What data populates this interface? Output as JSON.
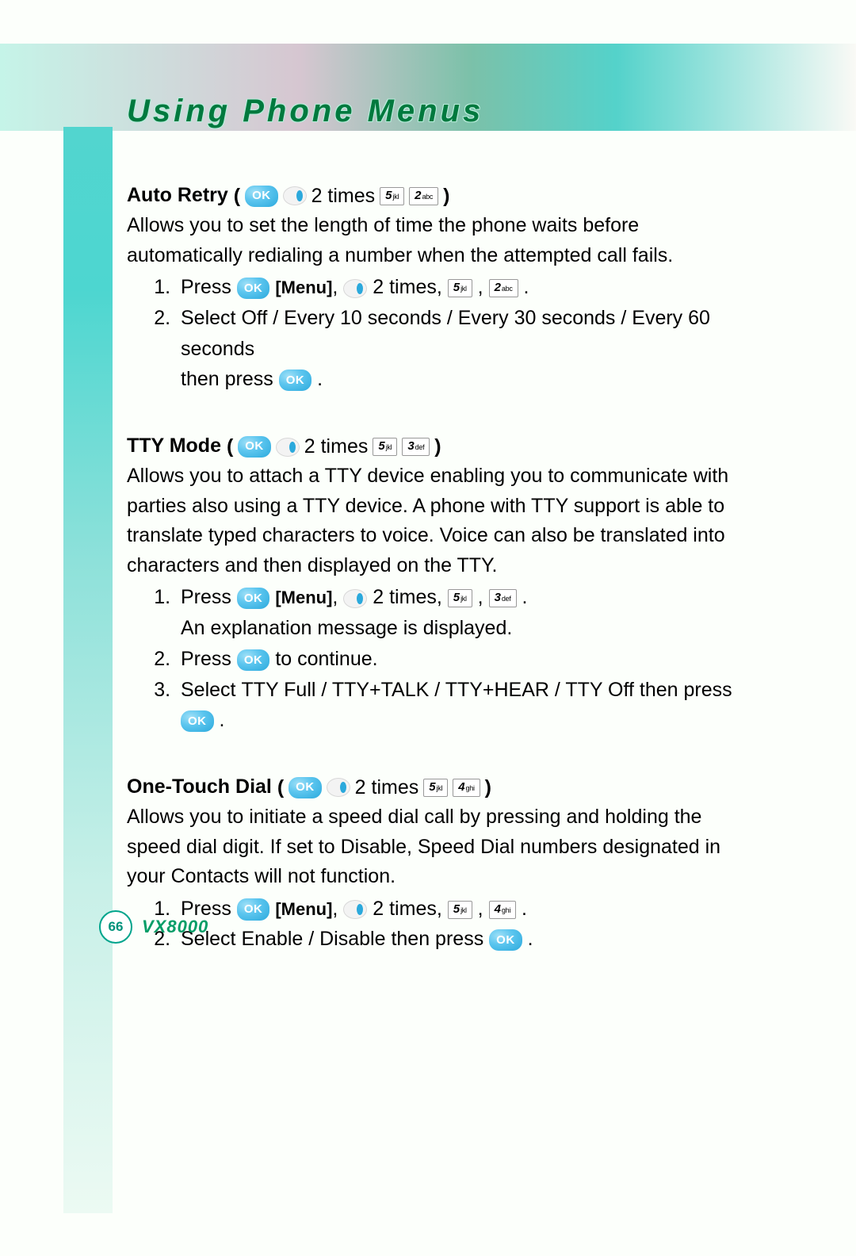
{
  "heading": "Using Phone Menus",
  "labels": {
    "ok": "OK",
    "twoTimes": "2 times",
    "twoTimesComma": "2 times,",
    "openParen": "(",
    "closeParen": ")",
    "comma": ",",
    "period": ".",
    "press": "Press",
    "menu": "[Menu]",
    "thenPress": "then press",
    "select": "Select",
    "toContinue": "to continue."
  },
  "keys": {
    "k2": {
      "num": "2",
      "letters": "abc"
    },
    "k3": {
      "num": "3",
      "letters": "def"
    },
    "k4": {
      "num": "4",
      "letters": "ghi"
    },
    "k5": {
      "num": "5",
      "letters": "jkl"
    }
  },
  "sections": {
    "autoRetry": {
      "title": "Auto Retry",
      "headKeyA": "k5",
      "headKeyB": "k2",
      "para": "Allows you to set the length of time the phone waits before automatically redialing a number when the attempted call fails.",
      "step1KeyA": "k5",
      "step1KeyB": "k2",
      "step2Options": "Off / Every 10 seconds / Every 30 seconds / Every 60 seconds"
    },
    "ttyMode": {
      "title": "TTY Mode",
      "headKeyA": "k5",
      "headKeyB": "k3",
      "para": "Allows you to attach a TTY device enabling you to communicate with parties also using a TTY device. A phone with TTY support is able to translate typed characters to voice. Voice can also be translated into characters and then displayed on the TTY.",
      "step1KeyA": "k5",
      "step1KeyB": "k3",
      "step1Tail": "An explanation message is displayed.",
      "step3Options": "TTY Full / TTY+TALK / TTY+HEAR / TTY Off"
    },
    "oneTouch": {
      "title": "One-Touch Dial",
      "headKeyA": "k5",
      "headKeyB": "k4",
      "paraPre": "Allows you to initiate a speed dial call by pressing and holding the speed dial digit. If set to ",
      "paraMid": "Disable",
      "paraPost": ", Speed Dial numbers designated in your Contacts will not function.",
      "step1KeyA": "k5",
      "step1KeyB": "k4",
      "step2Options": "Enable / Disable"
    }
  },
  "footer": {
    "pageNumber": "66",
    "model": "VX8000"
  }
}
